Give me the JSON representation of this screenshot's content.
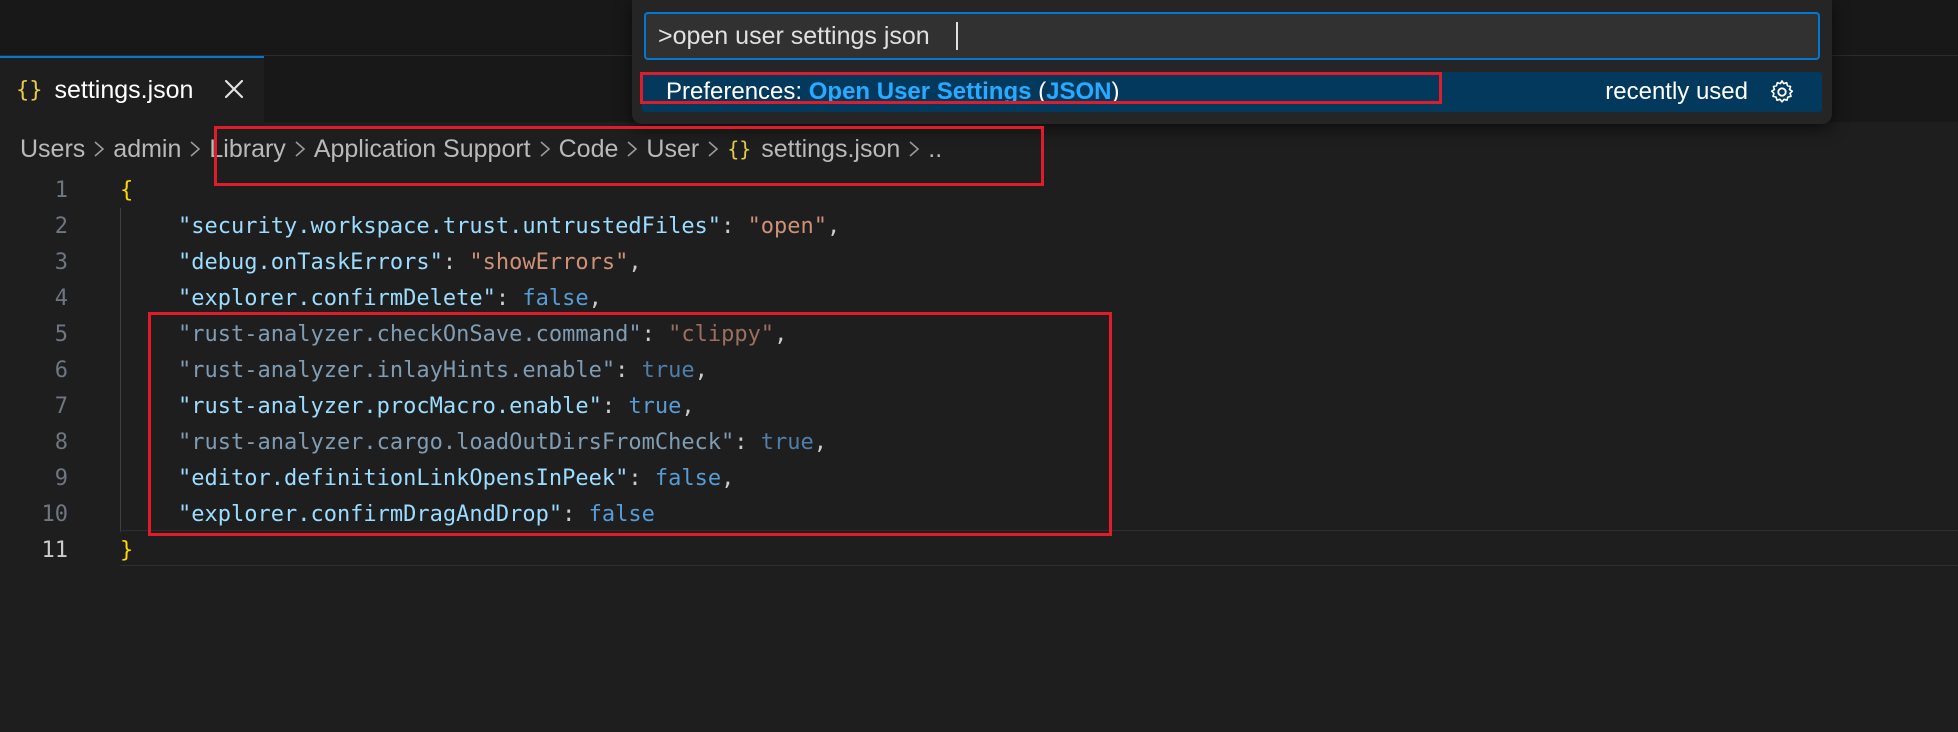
{
  "colors": {
    "accent": "#0078d4",
    "annotation": "#e01c2a",
    "json_icon": "#e8c94a",
    "highlight": "#2aaaff"
  },
  "tab": {
    "icon": "json-braces-icon",
    "icon_glyph": "{}",
    "label": "settings.json",
    "close_icon": "close-icon"
  },
  "breadcrumb": {
    "items": [
      "Users",
      "admin",
      "Library",
      "Application Support",
      "Code",
      "User"
    ],
    "file_icon_glyph": "{}",
    "file": "settings.json",
    "trail": "..",
    "separator_icon": "chevron-right-icon"
  },
  "palette": {
    "query": ">open user settings json",
    "result": {
      "prefix": "Preferences: ",
      "match1": "Open User Settings",
      "mid_open": " (",
      "match2": "JSON",
      "mid_close": ")",
      "hint": "recently used",
      "hint_icon": "gear-icon"
    }
  },
  "editor": {
    "line_numbers": [
      "1",
      "2",
      "3",
      "4",
      "5",
      "6",
      "7",
      "8",
      "9",
      "10",
      "11"
    ],
    "open_brace": "{",
    "close_brace": "}",
    "entries": [
      {
        "key": "\"security.workspace.trust.untrustedFiles\"",
        "value": "\"open\"",
        "sep": ","
      },
      {
        "key": "\"debug.onTaskErrors\"",
        "value": "\"showErrors\"",
        "sep": ","
      },
      {
        "key": "\"explorer.confirmDelete\"",
        "value": "false",
        "sep": ","
      },
      {
        "key": "\"rust-analyzer.checkOnSave.command\"",
        "value": "\"clippy\"",
        "sep": ","
      },
      {
        "key": "\"rust-analyzer.inlayHints.enable\"",
        "value": "true",
        "sep": ","
      },
      {
        "key": "\"rust-analyzer.procMacro.enable\"",
        "value": "true",
        "sep": ","
      },
      {
        "key": "\"rust-analyzer.cargo.loadOutDirsFromCheck\"",
        "value": "true",
        "sep": ","
      },
      {
        "key": "\"editor.definitionLinkOpensInPeek\"",
        "value": "false",
        "sep": ","
      },
      {
        "key": "\"explorer.confirmDragAndDrop\"",
        "value": "false",
        "sep": ""
      }
    ],
    "colon": ": "
  }
}
